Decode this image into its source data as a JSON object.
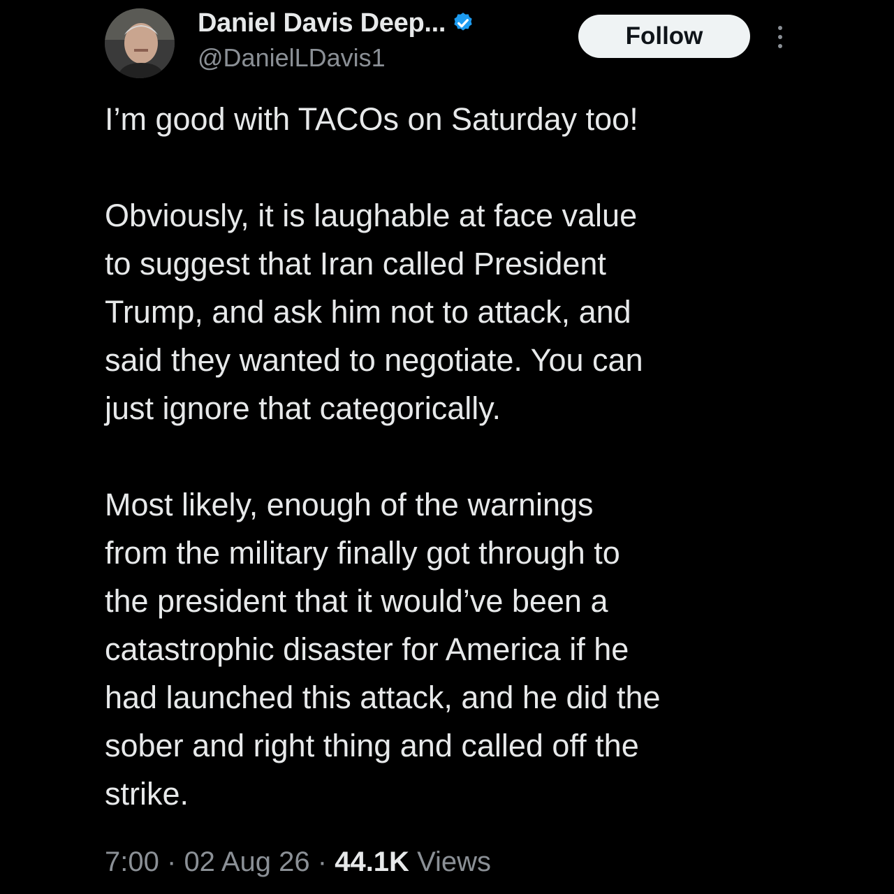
{
  "author": {
    "display_name": "Daniel Davis Deep...",
    "handle": "@DanielLDavis1",
    "verified": true
  },
  "actions": {
    "follow_label": "Follow",
    "more_icon": "more-vertical-icon"
  },
  "tweet": {
    "paragraph_1": "I’m good with TACOs on Saturday too!",
    "paragraph_2": "Obviously, it is laughable at face value\nto suggest that Iran called President\nTrump, and ask him not to attack, and\nsaid they wanted to negotiate. You can\njust ignore that categorically.",
    "paragraph_3": "Most likely, enough of the warnings\nfrom the military finally got through to\nthe president that it would’ve been a\ncatastrophic disaster for America if he\nhad launched this attack, and he did the\nsober and right thing and called off the\nstrike."
  },
  "meta": {
    "time": "7:00",
    "date": "02 Aug 26",
    "views_count": "44.1K",
    "views_label": "Views",
    "separator": "·"
  },
  "colors": {
    "background": "#000000",
    "text": "#e7e9ea",
    "secondary_text": "#8b9096",
    "verified_badge": "#1d9bf0",
    "follow_button_bg": "#eff3f4"
  }
}
